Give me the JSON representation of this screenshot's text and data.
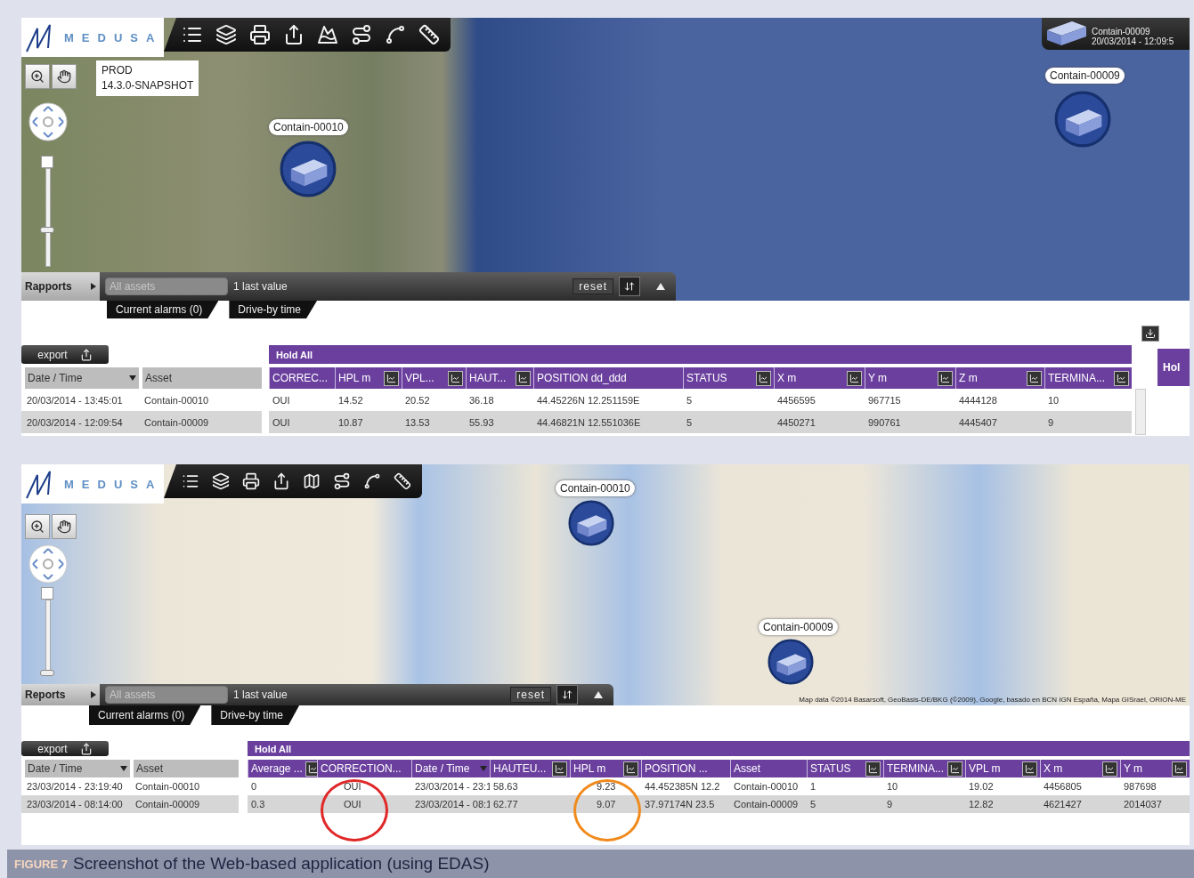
{
  "panels": [
    {
      "kind": "satellite",
      "logo": "MEDUSA",
      "tools": [
        {
          "kind": "list"
        },
        {
          "kind": "layers"
        },
        {
          "kind": "printer"
        },
        {
          "kind": "share"
        },
        {
          "kind": "terrain"
        },
        {
          "kind": "route"
        },
        {
          "kind": "line"
        },
        {
          "kind": "ruler"
        }
      ],
      "version": [
        "PROD",
        "14.3.0-SNAPSHOT"
      ],
      "zoom": {
        "level": 0.37
      },
      "info": {
        "title": "Contain-00009",
        "time": "20/03/2014 - 12:09:5"
      },
      "markers": [
        {
          "label": "Contain-00010"
        },
        {
          "label": "Contain-00009"
        }
      ],
      "reports": "Rapports",
      "search": {
        "placeholder": "All assets"
      },
      "last_value": "1 last value",
      "reset": "reset",
      "tabs": [
        {
          "label": "Current alarms (0)"
        },
        {
          "label": "Drive-by time"
        }
      ],
      "export": "export",
      "side_tab": "Hol",
      "table": {
        "group": "Hold All",
        "fixed_columns": [
          {
            "label": "Date / Time",
            "sorted": true
          },
          {
            "label": "Asset",
            "sorted": false
          }
        ],
        "fixed_rows": [
          [
            "20/03/2014 - 13:45:01",
            "Contain-00010"
          ],
          [
            "20/03/2014 - 12:09:54",
            "Contain-00009"
          ]
        ],
        "columns": [
          {
            "label": "CORREC...",
            "chart": false,
            "sorted": false
          },
          {
            "label": "HPL m",
            "chart": true,
            "sorted": false
          },
          {
            "label": "VPL...",
            "chart": true,
            "sorted": false
          },
          {
            "label": "HAUT...",
            "chart": true,
            "sorted": false
          },
          {
            "label": "POSITION dd_ddd",
            "chart": false,
            "sorted": false
          },
          {
            "label": "STATUS",
            "chart": true,
            "sorted": false
          },
          {
            "label": "X m",
            "chart": true,
            "sorted": false
          },
          {
            "label": "Y m",
            "chart": true,
            "sorted": false
          },
          {
            "label": "Z m",
            "chart": true,
            "sorted": false
          },
          {
            "label": "TERMINA...",
            "chart": true,
            "sorted": false
          }
        ],
        "rows": [
          [
            "OUI",
            "14.52",
            "20.52",
            "36.18",
            "44.45226N 12.251159E",
            "5",
            "4456595",
            "967715",
            "4444128",
            "10"
          ],
          [
            "OUI",
            "10.87",
            "13.53",
            "55.93",
            "44.46821N 12.551036E",
            "5",
            "4450271",
            "990761",
            "4445407",
            "9"
          ]
        ]
      }
    },
    {
      "kind": "road",
      "logo": "MEDUSA",
      "tools": [
        {
          "kind": "list"
        },
        {
          "kind": "layers"
        },
        {
          "kind": "printer"
        },
        {
          "kind": "share"
        },
        {
          "kind": "map"
        },
        {
          "kind": "route"
        },
        {
          "kind": "line"
        },
        {
          "kind": "ruler"
        }
      ],
      "zoom": {
        "level": 0.0
      },
      "markers": [
        {
          "label": "Contain-00010"
        },
        {
          "label": "Contain-00009"
        }
      ],
      "reports": "Reports",
      "search": {
        "placeholder": "All assets"
      },
      "last_value": "1 last value",
      "reset": "reset",
      "attribution": "Map data ©2014 Basarsoft, GeoBasis-DE/BKG (©2009), Google, basado en BCN IGN España, Mapa GISrael, ORION-ME",
      "tabs": [
        {
          "label": "Current alarms (0)"
        },
        {
          "label": "Drive-by time"
        }
      ],
      "export": "export",
      "table": {
        "group": "Hold All",
        "fixed_columns": [
          {
            "label": "Date / Time",
            "sorted": true
          },
          {
            "label": "Asset",
            "sorted": false
          }
        ],
        "fixed_rows": [
          [
            "23/03/2014 - 23:19:40",
            "Contain-00010"
          ],
          [
            "23/03/2014 - 08:14:00",
            "Contain-00009"
          ]
        ],
        "columns": [
          {
            "label": "Average ...",
            "chart": true,
            "sorted": false
          },
          {
            "label": "CORRECTION...",
            "chart": false,
            "sorted": false,
            "color": "#e02828"
          },
          {
            "label": "Date / Time",
            "chart": false,
            "sorted": true
          },
          {
            "label": "HAUTEU...",
            "chart": true,
            "sorted": false
          },
          {
            "label": "HPL m",
            "chart": true,
            "sorted": false,
            "color": "#f08a1c"
          },
          {
            "label": "POSITION ...",
            "chart": false,
            "sorted": false
          },
          {
            "label": "Asset",
            "chart": false,
            "sorted": false
          },
          {
            "label": "STATUS",
            "chart": true,
            "sorted": false
          },
          {
            "label": "TERMINA...",
            "chart": true,
            "sorted": false
          },
          {
            "label": "VPL m",
            "chart": true,
            "sorted": false
          },
          {
            "label": "X m",
            "chart": true,
            "sorted": false
          },
          {
            "label": "Y m",
            "chart": true,
            "sorted": false
          }
        ],
        "rows": [
          [
            "0",
            "OUI",
            "23/03/2014 - 23:1",
            "58.63",
            "9.23",
            "44.452385N 12.2",
            "Contain-00010",
            "1",
            "10",
            "19.02",
            "4456805",
            "987698"
          ],
          [
            "0.3",
            "OUI",
            "23/03/2014 - 08:1",
            "62.77",
            "9.07",
            "37.97174N 23.5",
            "Contain-00009",
            "5",
            "9",
            "12.82",
            "4621427",
            "2014037"
          ]
        ]
      }
    }
  ],
  "caption": {
    "label": "FIGURE 7",
    "text": "Screenshot of the Web-based application (using EDAS)"
  }
}
